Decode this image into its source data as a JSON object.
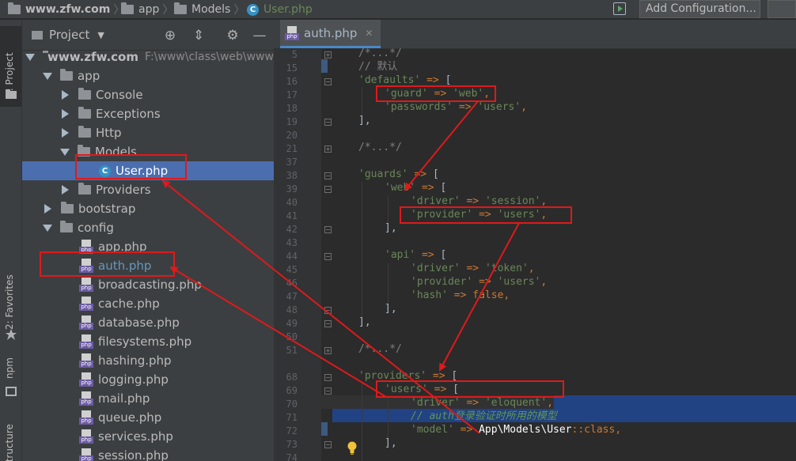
{
  "breadcrumb": {
    "root": "www.zfw.com",
    "items": [
      "app",
      "Models",
      "User.php"
    ]
  },
  "toolbar": {
    "add_configuration": "Add Configuration..."
  },
  "tool_strip": {
    "project_tab": "1: Project",
    "favorites_tab": "2: Favorites",
    "npm_tab": "npm",
    "structure_tab": "Z: Structure"
  },
  "project_panel": {
    "title": "Project",
    "root_name": "www.zfw.com",
    "root_path": "F:\\www\\class\\web\\www.",
    "tree": [
      {
        "label": "app"
      },
      {
        "label": "Console"
      },
      {
        "label": "Exceptions"
      },
      {
        "label": "Http"
      },
      {
        "label": "Models"
      },
      {
        "label": "User.php"
      },
      {
        "label": "Providers"
      },
      {
        "label": "bootstrap"
      },
      {
        "label": "config"
      },
      {
        "label": "app.php"
      },
      {
        "label": "auth.php"
      },
      {
        "label": "broadcasting.php"
      },
      {
        "label": "cache.php"
      },
      {
        "label": "database.php"
      },
      {
        "label": "filesystems.php"
      },
      {
        "label": "hashing.php"
      },
      {
        "label": "logging.php"
      },
      {
        "label": "mail.php"
      },
      {
        "label": "queue.php"
      },
      {
        "label": "services.php"
      },
      {
        "label": "session.php"
      }
    ]
  },
  "editor": {
    "tab_label": "auth.php",
    "line_numbers": [
      "5",
      "15",
      "16",
      "17",
      "18",
      "19",
      "20",
      "21",
      "37",
      "38",
      "39",
      "40",
      "41",
      "42",
      "43",
      "44",
      "45",
      "46",
      "47",
      "48",
      "49",
      "50",
      "51",
      "68",
      "69",
      "70",
      "71",
      "72",
      "73",
      "74"
    ],
    "code": {
      "l5": "/*...*/",
      "l15": "// 默认",
      "l16_key": "'defaults'",
      "l17_key": "'guard'",
      "l17_val": "'web'",
      "l18_key": "'passwords'",
      "l18_val": "'users'",
      "l19": "],",
      "l21": "/*...*/",
      "l38_key": "'guards'",
      "l39_key": "'web'",
      "l40_key": "'driver'",
      "l40_val": "'session'",
      "l41_key": "'provider'",
      "l41_val": "'users'",
      "l42": "],",
      "l44_key": "'api'",
      "l45_key": "'driver'",
      "l45_val": "'token'",
      "l46_key": "'provider'",
      "l46_val": "'users'",
      "l47_key": "'hash'",
      "l47_val": "false",
      "l48": "],",
      "l49": "],",
      "l51": "/*...*/",
      "l68_key": "'providers'",
      "l69_key": "'users'",
      "l70_key": "'driver'",
      "l70_val": "'eloquent'",
      "l71": "// auth登录验证时所用的模型",
      "l72_key": "'model'",
      "l72_val": "App\\Models\\User",
      "l72_tail": "::class",
      "l73": "],"
    }
  },
  "colors": {
    "annotation": "#e0191b",
    "selection": "#4b6eaf",
    "tab_underline": "#4a88c7"
  }
}
